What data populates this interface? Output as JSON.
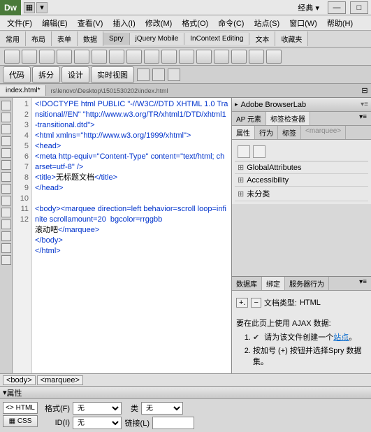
{
  "titlebar": {
    "logo": "Dw",
    "classic": "经典 ▾",
    "min": "—",
    "max": "□"
  },
  "menu": [
    "文件(F)",
    "编辑(E)",
    "查看(V)",
    "插入(I)",
    "修改(M)",
    "格式(O)",
    "命令(C)",
    "站点(S)",
    "窗口(W)",
    "帮助(H)"
  ],
  "insert_tabs": [
    "常用",
    "布局",
    "表单",
    "数据",
    "Spry",
    "jQuery Mobile",
    "InContext Editing",
    "文本",
    "收藏夹"
  ],
  "doc_toolbar": {
    "code": "代码",
    "split": "拆分",
    "design": "设计",
    "live": "实时视图"
  },
  "file_tab": "index.html*",
  "path_bar": "rs\\lenovo\\Desktop\\1501530202\\index.html",
  "code_lines": [
    "<!DOCTYPE html PUBLIC \"-//W3C//DTD XHTML 1.0 Transitional//EN\" \"http://www.w3.org/TR/xhtml1/DTD/xhtml1-transitional.dtd\">",
    "<html xmlns=\"http://www.w3.org/1999/xhtml\">",
    "<head>",
    "<meta http-equiv=\"Content-Type\" content=\"text/html; charset=utf-8\" />",
    "<title>无标题文档</title>",
    "</head>",
    "",
    "<body><marquee direction=left behavior=scroll loop=infinite scrollamount=20  bgcolor=rrggbb",
    "滚动吧</marquee>",
    "</body>",
    "</html>",
    ""
  ],
  "line_numbers": [
    "1",
    "2",
    "3",
    "4",
    "5",
    "6",
    "7",
    "8",
    "9",
    "10",
    "11",
    "12"
  ],
  "panels": {
    "browserlab": "Adobe BrowserLab",
    "ap_tab": "AP 元素",
    "tag_inspector_tab": "标签检查器",
    "attr_tab": "属性",
    "behavior_tab": "行为",
    "tags_label": "标签",
    "tags_value": "<marquee>",
    "attr_groups": [
      "GlobalAttributes",
      "Accessibility",
      "未分类"
    ],
    "db_tab": "数据库",
    "bind_tab": "绑定",
    "server_tab": "服务器行为",
    "doctype_label": "文档类型:",
    "doctype_value": "HTML",
    "ajax_heading": "要在此页上使用 AJAX 数据:",
    "ajax_step1_a": "请为该文件创建一个",
    "ajax_step1_link": "站点",
    "ajax_step1_b": "。",
    "ajax_step2": "按加号 (+) 按钮并选择Spry 数据集。"
  },
  "tag_selector": [
    "<body>",
    "<marquee>"
  ],
  "props": {
    "title": "属性",
    "html_btn": "<> HTML",
    "css_btn": "▦ CSS",
    "format_label": "格式(F)",
    "format_value": "无",
    "class_label": "类",
    "class_value": "无",
    "id_label": "ID(I)",
    "id_value": "无",
    "link_label": "链接(L)"
  }
}
